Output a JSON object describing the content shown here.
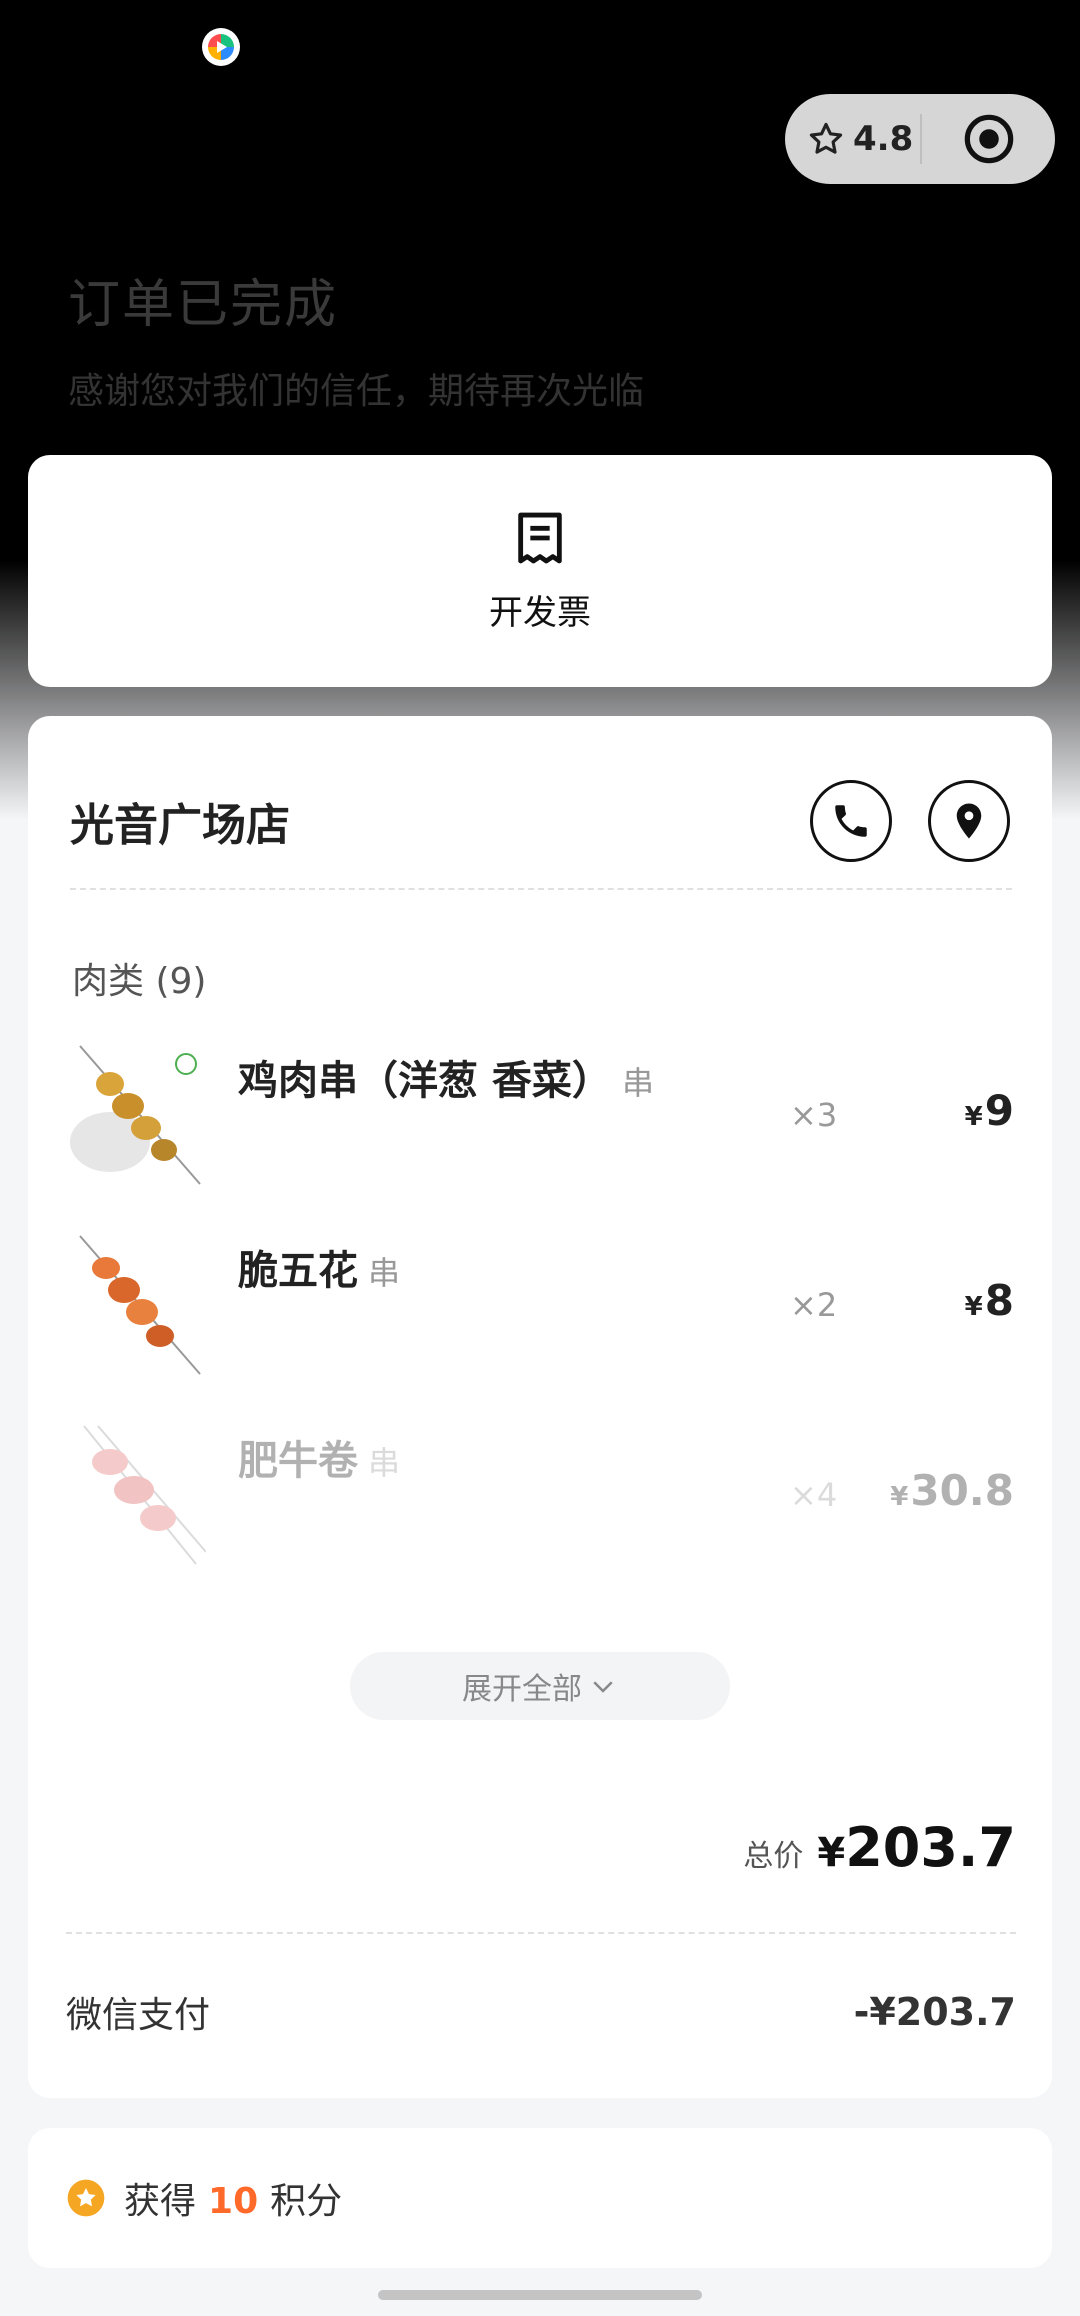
{
  "capsule": {
    "rating": "4.8"
  },
  "hero": {
    "title": "订单已完成",
    "subtitle": "感谢您对我们的信任，期待再次光临"
  },
  "invoice": {
    "label": "开发票"
  },
  "store": {
    "name": "光音广场店"
  },
  "category": {
    "label": "肉类 (9)"
  },
  "items": [
    {
      "name": "鸡肉串（洋葱 香菜）",
      "unit": "串",
      "qty": "×3",
      "currency": "¥",
      "price": "9"
    },
    {
      "name": "脆五花",
      "unit": "串",
      "qty": "×2",
      "currency": "¥",
      "price": "8"
    },
    {
      "name": "肥牛卷",
      "unit": "串",
      "qty": "×4",
      "currency": "¥",
      "price": "30.8"
    }
  ],
  "expand": {
    "label": "展开全部"
  },
  "total": {
    "label": "总价",
    "currency": "¥",
    "value": "203.7"
  },
  "payment": {
    "method": "微信支付",
    "amount": "-¥203.7"
  },
  "points": {
    "prefix": "获得",
    "value": "10",
    "suffix": "积分"
  },
  "colors": {
    "accent": "#ff6a2b",
    "badge": "#f5a623"
  }
}
